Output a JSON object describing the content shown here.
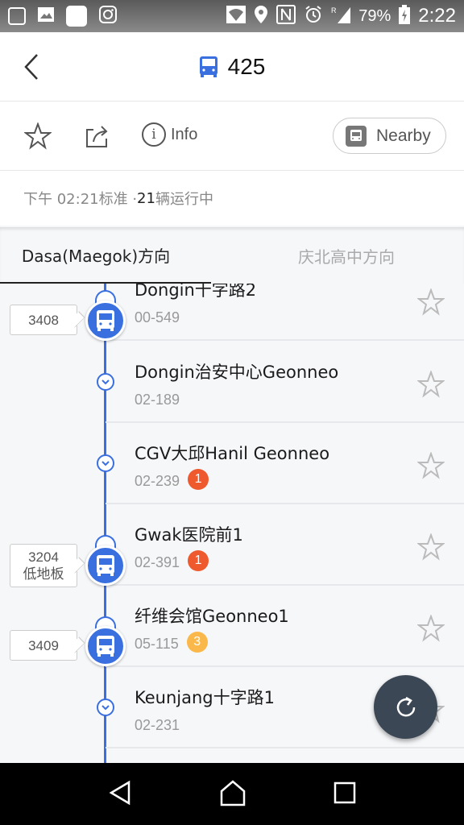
{
  "statusbar": {
    "left_icons": [
      "sync-icon",
      "image-icon",
      "blank-app-icon",
      "instagram-icon"
    ],
    "right_icons": [
      "wifi-icon",
      "location-icon",
      "nfc-icon",
      "alarm-icon",
      "signal-icon",
      "battery-charging-icon"
    ],
    "battery": "79%",
    "time": "2:22"
  },
  "header": {
    "back_icon": "chevron-left-icon",
    "bus_icon": "bus-icon",
    "route_number": "425",
    "accent_color": "#3a6fe0"
  },
  "toolbar": {
    "favorite_icon": "star-icon",
    "share_icon": "share-icon",
    "info_label": "Info",
    "nearby_label": "Nearby"
  },
  "status": {
    "time_text": "下午 02:21标准 · ",
    "count_text": "21",
    "suffix_text": "辆运行中"
  },
  "tabs": [
    {
      "label": "Dasa(Maegok)方向",
      "active": true
    },
    {
      "label": "庆北高中方向",
      "active": false
    }
  ],
  "stops": [
    {
      "name": "Dongin十字路2",
      "code": "00-549",
      "badge": null,
      "bus": {
        "number": "3408",
        "note": null
      }
    },
    {
      "name": "Dongin治安中心Geonneo",
      "code": "02-189",
      "badge": null,
      "bus": null
    },
    {
      "name": "CGV大邱Hanil Geonneo",
      "code": "02-239",
      "badge": {
        "value": "1",
        "color": "#ee5a2e"
      },
      "bus": null
    },
    {
      "name": "Gwak医院前1",
      "code": "02-391",
      "badge": {
        "value": "1",
        "color": "#ee5a2e"
      },
      "bus": {
        "number": "3204",
        "note": "低地板"
      }
    },
    {
      "name": "纤维会馆Geonneo1",
      "code": "05-115",
      "badge": {
        "value": "3",
        "color": "#fbb84a"
      },
      "bus": {
        "number": "3409",
        "note": null
      }
    },
    {
      "name": "Keunjang十字路1",
      "code": "02-231",
      "badge": null,
      "bus": null
    }
  ],
  "fab": {
    "icon": "refresh-icon"
  },
  "navbar": {
    "icons": [
      "back-triangle-icon",
      "home-icon",
      "recents-icon"
    ]
  }
}
